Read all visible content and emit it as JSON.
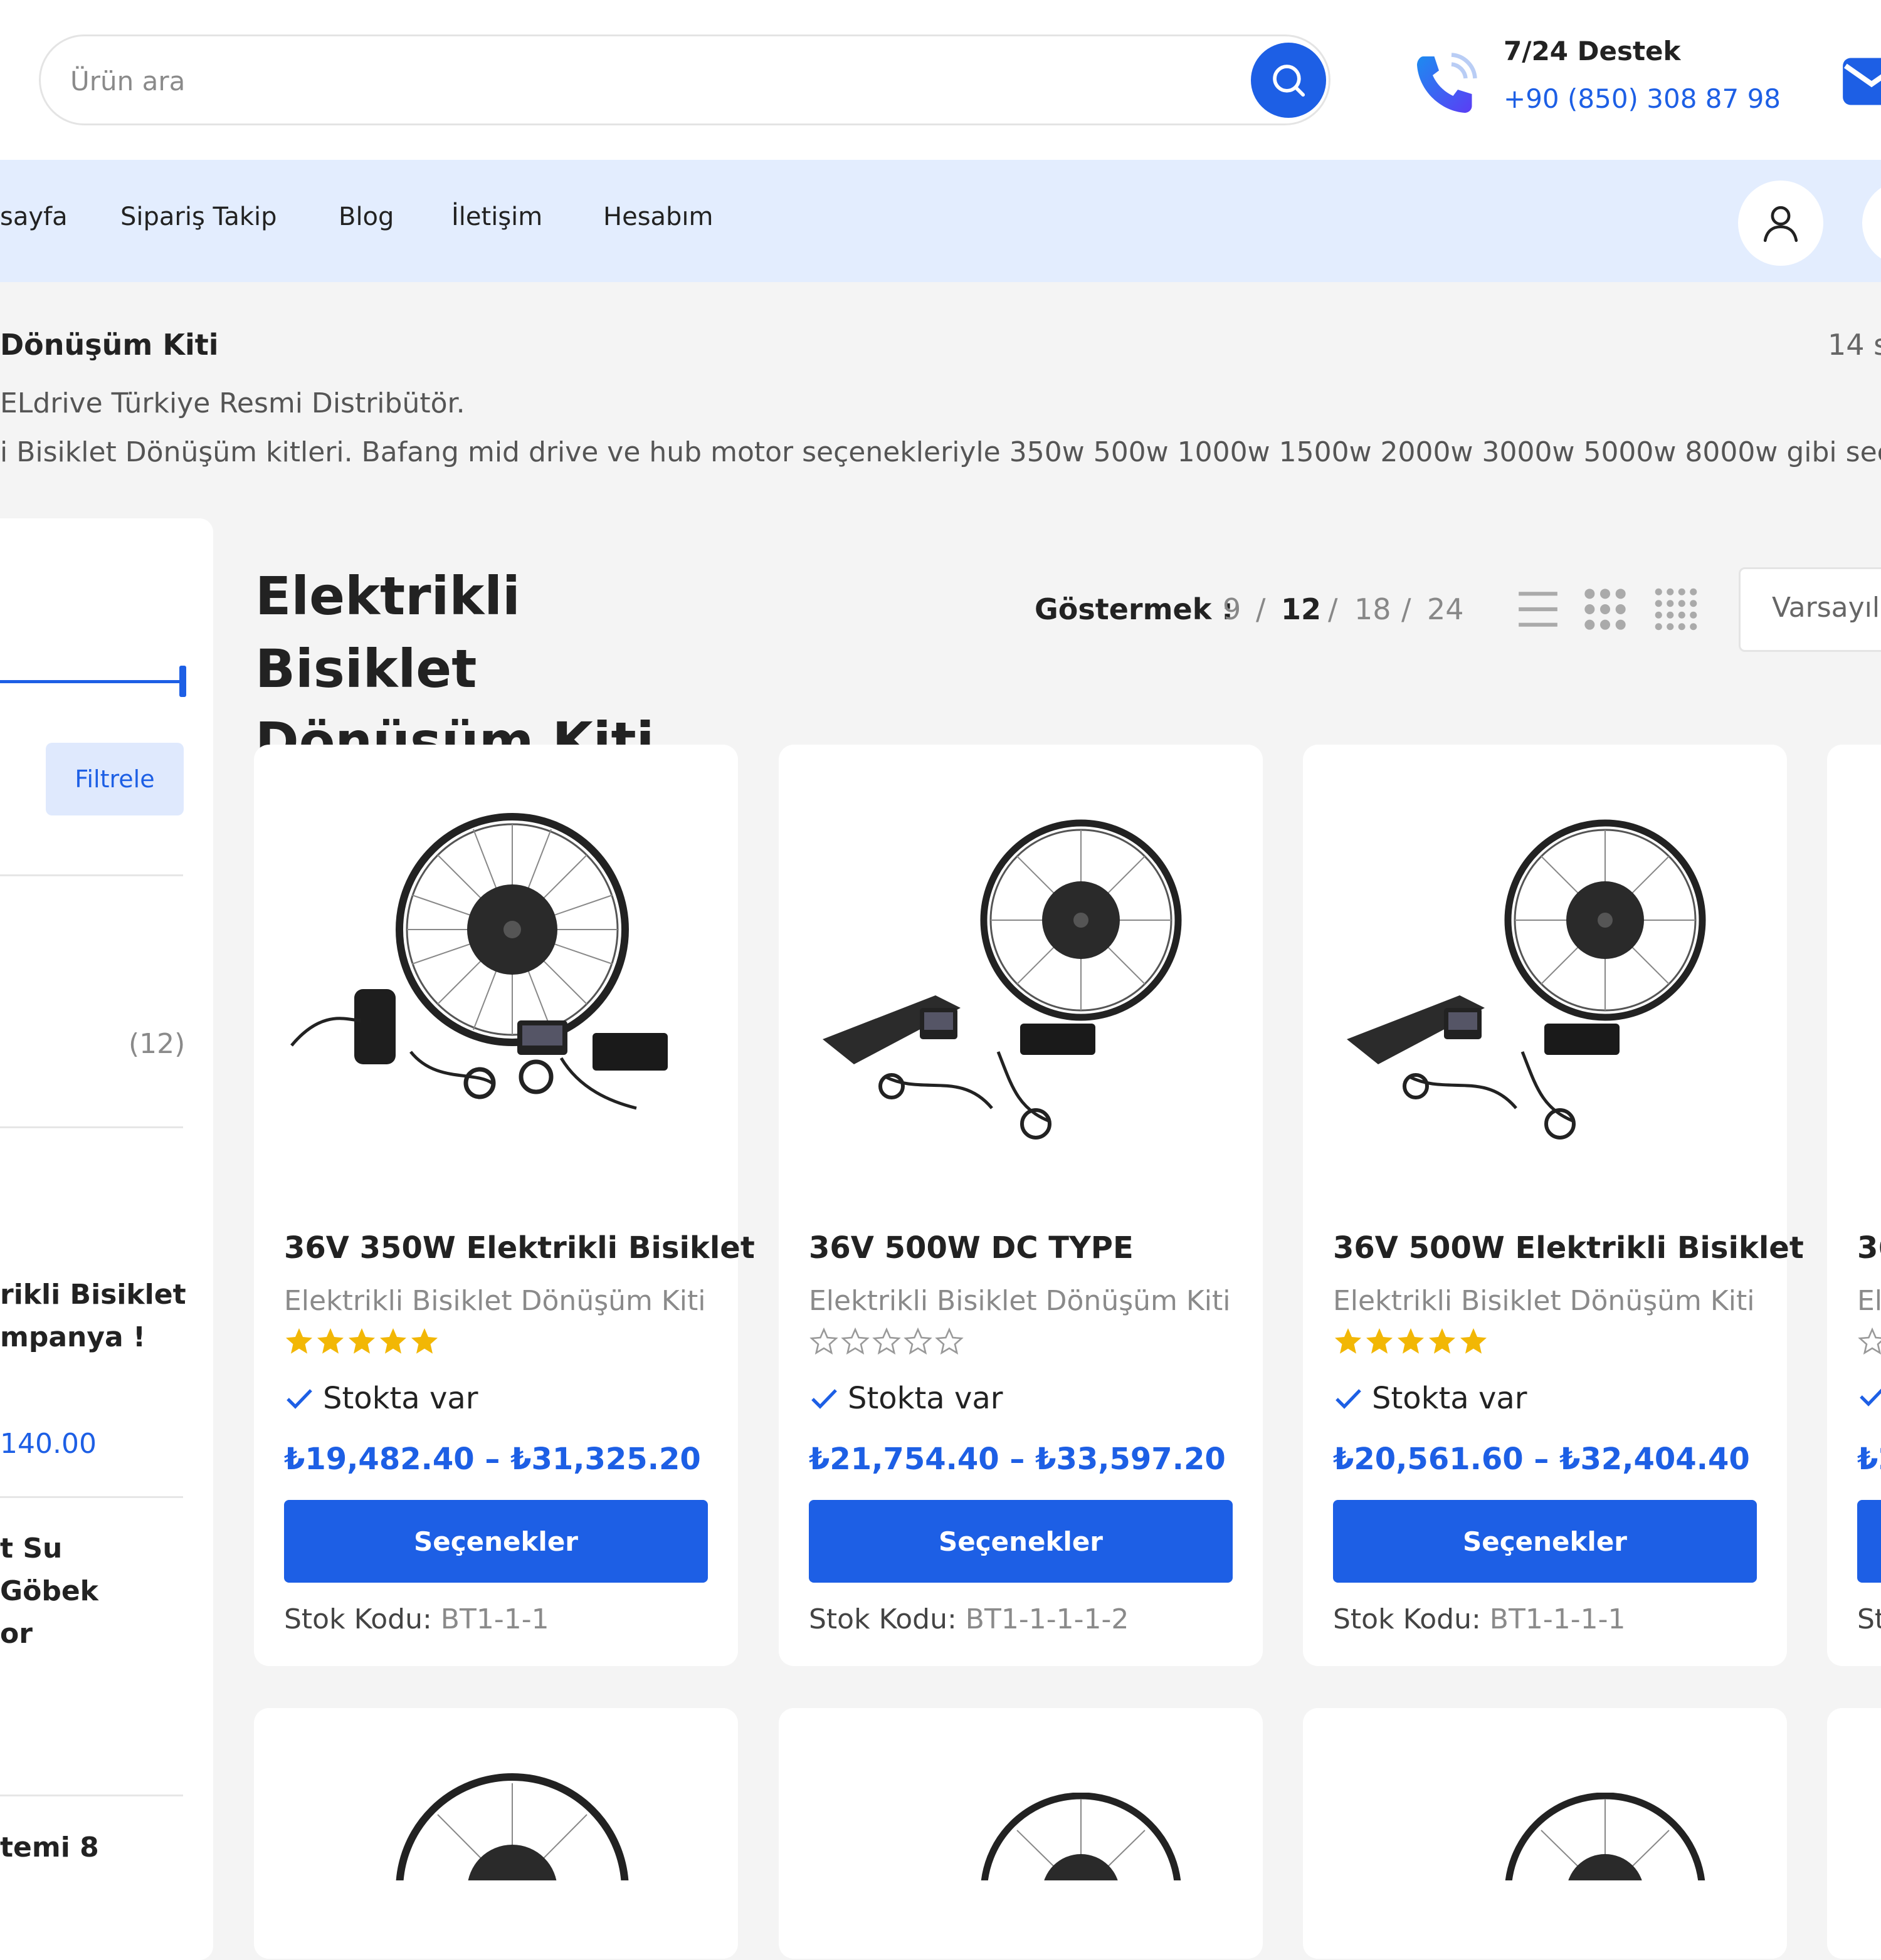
{
  "header": {
    "search_placeholder": "Ürün ara",
    "search_icon": "search-icon",
    "support_title": "7/24 Destek",
    "support_phone": "+90 (850) 308 87 98",
    "phone_icon": "phone-icon",
    "mail_icon": "mail-icon"
  },
  "nav": {
    "items": [
      {
        "label": "sayfa"
      },
      {
        "label": "Sipariş Takip"
      },
      {
        "label": "Blog"
      },
      {
        "label": "İletişim"
      },
      {
        "label": "Hesabım"
      }
    ],
    "account_icon": "user-icon"
  },
  "category": {
    "name": "Dönüşüm Kiti",
    "count": "14 s",
    "desc_line1": "ELdrive Türkiye Resmi Distribütör.",
    "desc_line2": "i Bisiklet Dönüşüm kitleri. Bafang mid drive ve hub motor seçenekleriyle 350w 500w 1000w 1500w 2000w 3000w 5000w 8000w gibi seç"
  },
  "sidebar": {
    "filter_label": "Filtrele",
    "category_count": "(12)",
    "items": [
      {
        "line1": "rikli Bisiklet",
        "line2": "mpanya !",
        "price": "140.00"
      },
      {
        "line1": "t Su",
        "line2": "Göbek",
        "line3": "or"
      },
      {
        "line1": "temi 8"
      }
    ]
  },
  "main": {
    "title": "Elektrikli Bisiklet Dönüşüm Kiti",
    "show_label": "Göstermek :",
    "per_page": [
      "9",
      "12",
      "18",
      "24"
    ],
    "per_page_active": "12",
    "sort_label": "Varsayıla",
    "view_icons": [
      "list-view-icon",
      "grid-3-icon",
      "grid-4-icon"
    ]
  },
  "products": [
    {
      "title": "36V 350W Elektrikli Bisiklet",
      "category": "Elektrikli Bisiklet Dönüşüm Kiti",
      "rating": 5,
      "stock": "Stokta var",
      "price": "₺19,482.40 – ₺31,325.20",
      "button": "Seçenekler",
      "sku_label": "Stok Kodu:",
      "sku": "BT1-1-1"
    },
    {
      "title": "36V 500W DC TYPE",
      "category": "Elektrikli Bisiklet Dönüşüm Kiti",
      "rating": 0,
      "stock": "Stokta var",
      "price": "₺21,754.40 – ₺33,597.20",
      "button": "Seçenekler",
      "sku_label": "Stok Kodu:",
      "sku": "BT1-1-1-1-2"
    },
    {
      "title": "36V 500W Elektrikli Bisiklet",
      "category": "Elektrikli Bisiklet Dönüşüm Kiti",
      "rating": 5,
      "stock": "Stokta var",
      "price": "₺20,561.60 – ₺32,404.40",
      "button": "Seçenekler",
      "sku_label": "Stok Kodu:",
      "sku": "BT1-1-1-1"
    },
    {
      "title": "36",
      "category": "El",
      "rating": 0,
      "stock": "",
      "price": "₺2",
      "button": "",
      "sku_label": "St",
      "sku": ""
    }
  ],
  "colors": {
    "accent": "#1d5fe5",
    "nav_bg": "#e3edfe",
    "page_bg": "#f4f4f4",
    "star": "#f2b705"
  }
}
